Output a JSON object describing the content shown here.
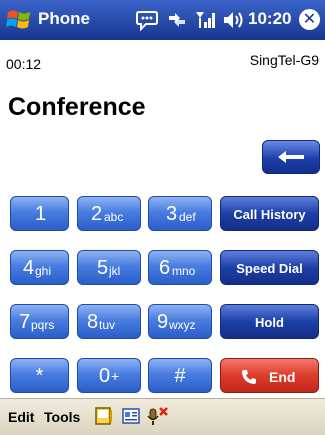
{
  "titlebar": {
    "app_title": "Phone",
    "clock": "10:20"
  },
  "call": {
    "timer": "00:12",
    "carrier": "SingTel-G9",
    "status": "Conference"
  },
  "keypad": [
    {
      "digit": "1",
      "letters": ""
    },
    {
      "digit": "2",
      "letters": "abc"
    },
    {
      "digit": "3",
      "letters": "def"
    },
    {
      "digit": "4",
      "letters": "ghi"
    },
    {
      "digit": "5",
      "letters": "jkl"
    },
    {
      "digit": "6",
      "letters": "mno"
    },
    {
      "digit": "7",
      "letters": "pqrs"
    },
    {
      "digit": "8",
      "letters": "tuv"
    },
    {
      "digit": "9",
      "letters": "wxyz"
    },
    {
      "digit": "*",
      "letters": ""
    },
    {
      "digit": "0",
      "letters": "+"
    },
    {
      "digit": "#",
      "letters": ""
    }
  ],
  "actions": {
    "call_history": "Call History",
    "speed_dial": "Speed Dial",
    "hold": "Hold",
    "end": "End"
  },
  "menubar": {
    "edit": "Edit",
    "tools": "Tools"
  },
  "colors": {
    "titlebar": "#1c3f9e",
    "number_key": "#4a7de0",
    "action_key": "#1d3fa8",
    "end_key": "#dc3b2b"
  }
}
